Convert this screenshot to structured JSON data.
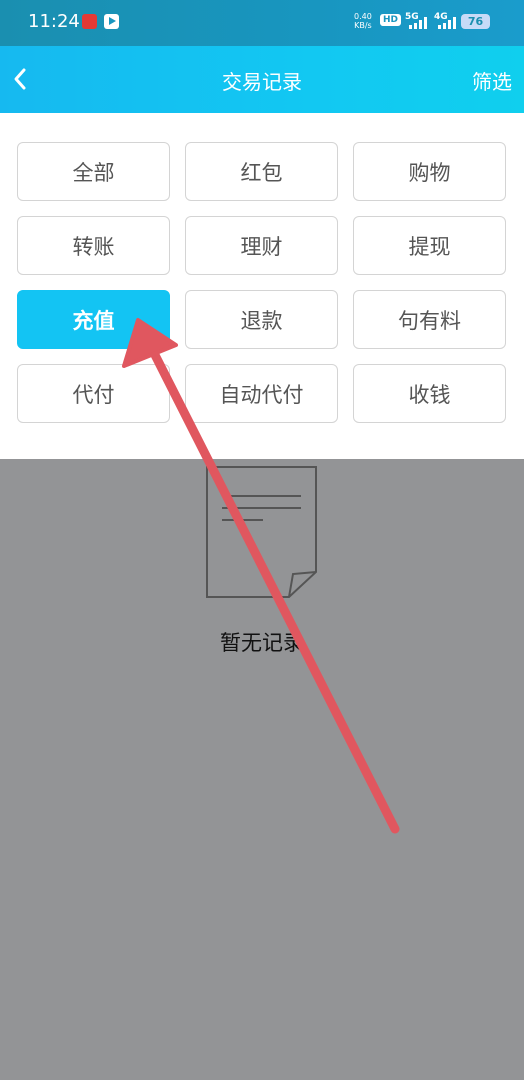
{
  "status_bar": {
    "time": "11:24",
    "net_speed_value": "0.40",
    "net_speed_unit": "KB/s",
    "hd_label": "HD",
    "sim1_label": "5G",
    "sim2_label": "4G",
    "battery": "76"
  },
  "header": {
    "title": "交易记录",
    "filter_label": "筛选"
  },
  "filters": [
    {
      "label": "全部",
      "active": false
    },
    {
      "label": "红包",
      "active": false
    },
    {
      "label": "购物",
      "active": false
    },
    {
      "label": "转账",
      "active": false
    },
    {
      "label": "理财",
      "active": false
    },
    {
      "label": "提现",
      "active": false
    },
    {
      "label": "充值",
      "active": true
    },
    {
      "label": "退款",
      "active": false
    },
    {
      "label": "句有料",
      "active": false
    },
    {
      "label": "代付",
      "active": false
    },
    {
      "label": "自动代付",
      "active": false
    },
    {
      "label": "收钱",
      "active": false
    }
  ],
  "empty_state": {
    "message": "暂无记录",
    "icon": "document-icon"
  },
  "colors": {
    "header_gradient_start": "#16b9f0",
    "active_chip": "#13c4f3",
    "overlay_gray": "#939496",
    "annotation_arrow": "#e0575f"
  }
}
